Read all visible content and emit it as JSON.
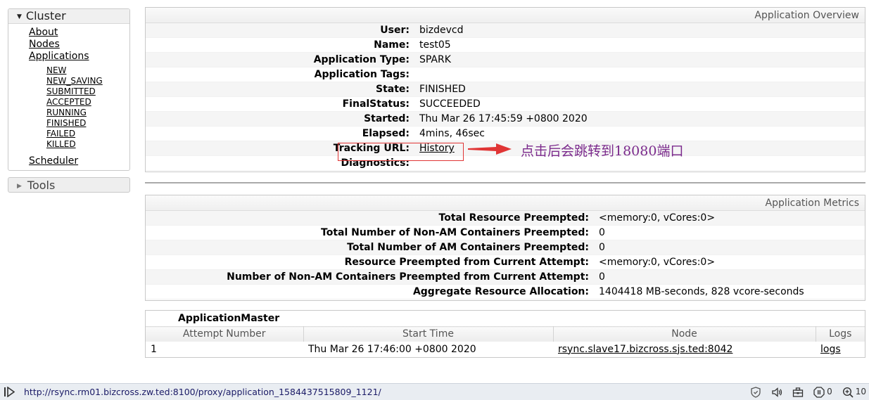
{
  "sidebar": {
    "cluster_header": "Cluster",
    "items": [
      "About",
      "Nodes",
      "Applications"
    ],
    "app_states": [
      "NEW",
      "NEW_SAVING",
      "SUBMITTED",
      "ACCEPTED",
      "RUNNING",
      "FINISHED",
      "FAILED",
      "KILLED"
    ],
    "scheduler": "Scheduler",
    "tools_header": "Tools"
  },
  "overview": {
    "title": "Application Overview",
    "rows": [
      {
        "label": "User:",
        "value": "bizdevcd"
      },
      {
        "label": "Name:",
        "value": "test05"
      },
      {
        "label": "Application Type:",
        "value": "SPARK"
      },
      {
        "label": "Application Tags:",
        "value": ""
      },
      {
        "label": "State:",
        "value": "FINISHED"
      },
      {
        "label": "FinalStatus:",
        "value": "SUCCEEDED"
      },
      {
        "label": "Started:",
        "value": "Thu Mar 26 17:45:59 +0800 2020"
      },
      {
        "label": "Elapsed:",
        "value": "4mins, 46sec"
      },
      {
        "label": "Tracking URL:",
        "value": "History"
      },
      {
        "label": "Diagnostics:",
        "value": ""
      }
    ]
  },
  "annotation": {
    "text": "点击后会跳转到18080端口",
    "color": "#7b2a8c",
    "arrow_color": "#e03535"
  },
  "metrics": {
    "title": "Application Metrics",
    "rows": [
      {
        "label": "Total Resource Preempted:",
        "value": "<memory:0, vCores:0>"
      },
      {
        "label": "Total Number of Non-AM Containers Preempted:",
        "value": "0"
      },
      {
        "label": "Total Number of AM Containers Preempted:",
        "value": "0"
      },
      {
        "label": "Resource Preempted from Current Attempt:",
        "value": "<memory:0, vCores:0>"
      },
      {
        "label": "Number of Non-AM Containers Preempted from Current Attempt:",
        "value": "0"
      },
      {
        "label": "Aggregate Resource Allocation:",
        "value": "1404418 MB-seconds, 828 vcore-seconds"
      }
    ]
  },
  "attempts": {
    "caption": "ApplicationMaster",
    "columns": [
      "Attempt Number",
      "Start Time",
      "Node",
      "Logs"
    ],
    "rows": [
      {
        "attempt": "1",
        "start": "Thu Mar 26 17:46:00 +0800 2020",
        "node": "rsync.slave17.bizcross.sjs.ted:8042",
        "logs": "logs"
      }
    ]
  },
  "statusbar": {
    "url": "http://rsync.rm01.bizcross.zw.ted:8100/proxy/application_1584437515809_1121/",
    "counter": "0",
    "zoom": "10"
  }
}
